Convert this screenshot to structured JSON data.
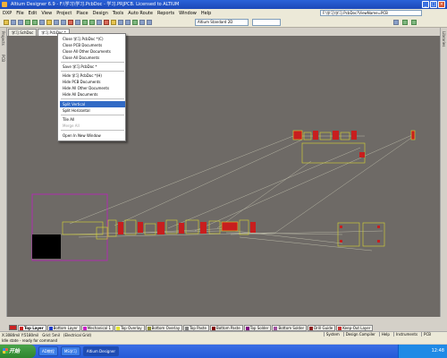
{
  "window": {
    "title": "Altium Designer 6.9 - F:\\学习\\学习.PcbDoc - 学习.PRJPCB. Licensed to ALTIUM"
  },
  "menubar": {
    "items": [
      "DXP",
      "File",
      "Edit",
      "View",
      "Project",
      "Place",
      "Design",
      "Tools",
      "Auto Route",
      "Reports",
      "Window",
      "Help"
    ],
    "path": "F:\\学习\\学习.PcbDoc?ViewName=PCB"
  },
  "toolbar": {
    "view_combo": "Altium Standard 2D"
  },
  "sidebar": {
    "left_labels": [
      "Projects",
      "PCB"
    ],
    "right_labels": [
      "Libraries"
    ]
  },
  "doc_tabs": [
    "学习.SchDoc",
    "学习.PcbDoc *"
  ],
  "context_menu": {
    "groups": [
      [
        "Close 学习.PcbDoc *(C)",
        "Close PCB Documents",
        "Close All Other Documents",
        "Close All Documents"
      ],
      [
        "Save 学习.PcbDoc *"
      ],
      [
        "Hide 学习.PcbDoc *(H)",
        "Hide PCB Documents",
        "Hide All Other Documents",
        "Hide All Documents"
      ],
      [
        "Split Vertical",
        "Split Horizontal"
      ],
      [
        "Tile All",
        "Merge All"
      ],
      [
        "Open In New Window"
      ]
    ],
    "highlighted": "Split Vertical",
    "disabled": [
      "Merge All"
    ]
  },
  "layers": [
    {
      "name": "Top Layer",
      "color": "#c81e1e",
      "active": true
    },
    {
      "name": "Bottom Layer",
      "color": "#1e3cc8"
    },
    {
      "name": "Mechanical 1",
      "color": "#c81ec8"
    },
    {
      "name": "Top Overlay",
      "color": "#e6e632"
    },
    {
      "name": "Bottom Overlay",
      "color": "#8c8c32"
    },
    {
      "name": "Top Paste",
      "color": "#808080"
    },
    {
      "name": "Bottom Paste",
      "color": "#800000"
    },
    {
      "name": "Top Solder",
      "color": "#800080"
    },
    {
      "name": "Bottom Solder",
      "color": "#a050a0"
    },
    {
      "name": "Drill Guide",
      "color": "#8c1e1e"
    },
    {
      "name": "Keep-Out Layer",
      "color": "#c83232"
    }
  ],
  "statusbar": {
    "coords": "X:3080mil Y:5180mil",
    "grid": "Grid: 5mil",
    "snap": "(Electrical Grid)",
    "panels": [
      "System",
      "Design Compiler",
      "Help",
      "Instruments",
      "PCB"
    ]
  },
  "hint": "Idle state - ready for command",
  "taskbar": {
    "start": "开始",
    "tasks": [
      "AD教程",
      "MS学习",
      "Altium Designer"
    ],
    "clock": "12:48"
  }
}
